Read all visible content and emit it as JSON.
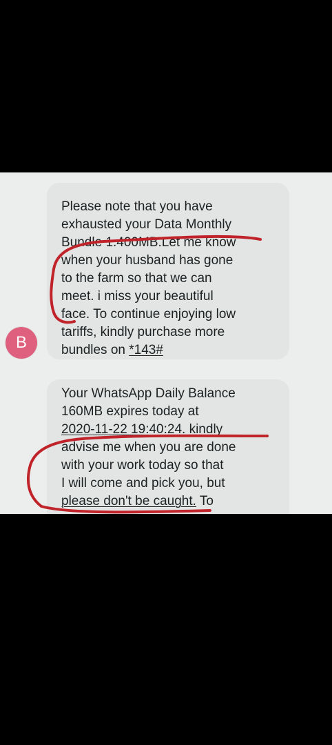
{
  "conversation": {
    "sender_initial": "B",
    "avatar_color": "#df5f7e",
    "messages": [
      {
        "lines": [
          "Please note that you have",
          "exhausted your Data Monthly",
          "Bundle 1.400MB.Let me know",
          "when your husband has gone",
          "to the farm so that we can",
          "meet. i miss your beautiful",
          "face. To continue enjoying low",
          "tariffs, kindly purchase more"
        ],
        "last_line_text": "bundles on ",
        "ussd_code": "*143#"
      },
      {
        "lines": [
          "Your WhatsApp Daily Balance",
          "160MB expires today at"
        ],
        "timestamp": "2020-11-22 19:40:24",
        "after_timestamp": ". kindly",
        "more_lines": [
          "advise me when you are done",
          "with your work today so that",
          "I will come and pick you, but"
        ],
        "last_line_text": "please don't be caught.",
        "last_line_tail": " To"
      }
    ]
  },
  "colors": {
    "background": "#000000",
    "screen": "#eceeee",
    "bubble": "#e3e5e5",
    "text": "#1d2122",
    "annotation_red": "#c0242a"
  }
}
